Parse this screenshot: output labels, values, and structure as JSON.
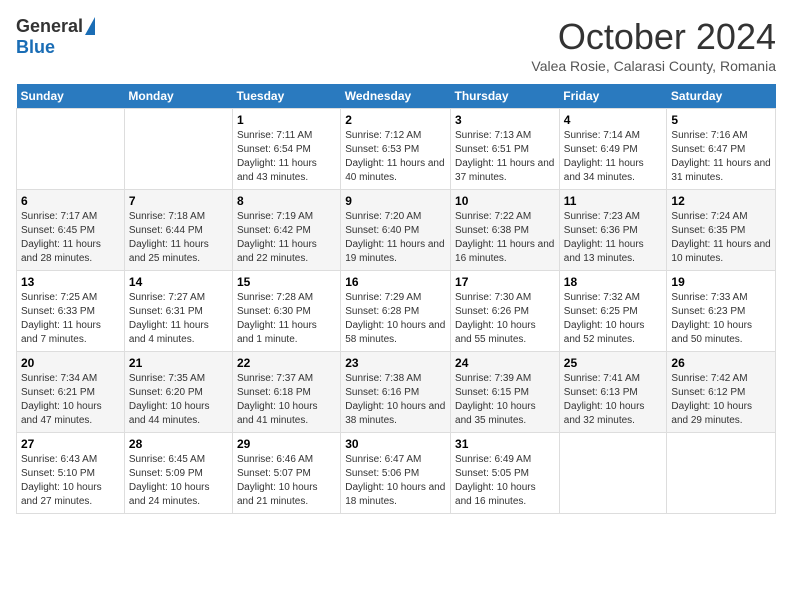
{
  "header": {
    "logo_general": "General",
    "logo_blue": "Blue",
    "month_title": "October 2024",
    "location": "Valea Rosie, Calarasi County, Romania"
  },
  "days_of_week": [
    "Sunday",
    "Monday",
    "Tuesday",
    "Wednesday",
    "Thursday",
    "Friday",
    "Saturday"
  ],
  "weeks": [
    [
      {
        "day": "",
        "sunrise": "",
        "sunset": "",
        "daylight": ""
      },
      {
        "day": "",
        "sunrise": "",
        "sunset": "",
        "daylight": ""
      },
      {
        "day": "1",
        "sunrise": "Sunrise: 7:11 AM",
        "sunset": "Sunset: 6:54 PM",
        "daylight": "Daylight: 11 hours and 43 minutes."
      },
      {
        "day": "2",
        "sunrise": "Sunrise: 7:12 AM",
        "sunset": "Sunset: 6:53 PM",
        "daylight": "Daylight: 11 hours and 40 minutes."
      },
      {
        "day": "3",
        "sunrise": "Sunrise: 7:13 AM",
        "sunset": "Sunset: 6:51 PM",
        "daylight": "Daylight: 11 hours and 37 minutes."
      },
      {
        "day": "4",
        "sunrise": "Sunrise: 7:14 AM",
        "sunset": "Sunset: 6:49 PM",
        "daylight": "Daylight: 11 hours and 34 minutes."
      },
      {
        "day": "5",
        "sunrise": "Sunrise: 7:16 AM",
        "sunset": "Sunset: 6:47 PM",
        "daylight": "Daylight: 11 hours and 31 minutes."
      }
    ],
    [
      {
        "day": "6",
        "sunrise": "Sunrise: 7:17 AM",
        "sunset": "Sunset: 6:45 PM",
        "daylight": "Daylight: 11 hours and 28 minutes."
      },
      {
        "day": "7",
        "sunrise": "Sunrise: 7:18 AM",
        "sunset": "Sunset: 6:44 PM",
        "daylight": "Daylight: 11 hours and 25 minutes."
      },
      {
        "day": "8",
        "sunrise": "Sunrise: 7:19 AM",
        "sunset": "Sunset: 6:42 PM",
        "daylight": "Daylight: 11 hours and 22 minutes."
      },
      {
        "day": "9",
        "sunrise": "Sunrise: 7:20 AM",
        "sunset": "Sunset: 6:40 PM",
        "daylight": "Daylight: 11 hours and 19 minutes."
      },
      {
        "day": "10",
        "sunrise": "Sunrise: 7:22 AM",
        "sunset": "Sunset: 6:38 PM",
        "daylight": "Daylight: 11 hours and 16 minutes."
      },
      {
        "day": "11",
        "sunrise": "Sunrise: 7:23 AM",
        "sunset": "Sunset: 6:36 PM",
        "daylight": "Daylight: 11 hours and 13 minutes."
      },
      {
        "day": "12",
        "sunrise": "Sunrise: 7:24 AM",
        "sunset": "Sunset: 6:35 PM",
        "daylight": "Daylight: 11 hours and 10 minutes."
      }
    ],
    [
      {
        "day": "13",
        "sunrise": "Sunrise: 7:25 AM",
        "sunset": "Sunset: 6:33 PM",
        "daylight": "Daylight: 11 hours and 7 minutes."
      },
      {
        "day": "14",
        "sunrise": "Sunrise: 7:27 AM",
        "sunset": "Sunset: 6:31 PM",
        "daylight": "Daylight: 11 hours and 4 minutes."
      },
      {
        "day": "15",
        "sunrise": "Sunrise: 7:28 AM",
        "sunset": "Sunset: 6:30 PM",
        "daylight": "Daylight: 11 hours and 1 minute."
      },
      {
        "day": "16",
        "sunrise": "Sunrise: 7:29 AM",
        "sunset": "Sunset: 6:28 PM",
        "daylight": "Daylight: 10 hours and 58 minutes."
      },
      {
        "day": "17",
        "sunrise": "Sunrise: 7:30 AM",
        "sunset": "Sunset: 6:26 PM",
        "daylight": "Daylight: 10 hours and 55 minutes."
      },
      {
        "day": "18",
        "sunrise": "Sunrise: 7:32 AM",
        "sunset": "Sunset: 6:25 PM",
        "daylight": "Daylight: 10 hours and 52 minutes."
      },
      {
        "day": "19",
        "sunrise": "Sunrise: 7:33 AM",
        "sunset": "Sunset: 6:23 PM",
        "daylight": "Daylight: 10 hours and 50 minutes."
      }
    ],
    [
      {
        "day": "20",
        "sunrise": "Sunrise: 7:34 AM",
        "sunset": "Sunset: 6:21 PM",
        "daylight": "Daylight: 10 hours and 47 minutes."
      },
      {
        "day": "21",
        "sunrise": "Sunrise: 7:35 AM",
        "sunset": "Sunset: 6:20 PM",
        "daylight": "Daylight: 10 hours and 44 minutes."
      },
      {
        "day": "22",
        "sunrise": "Sunrise: 7:37 AM",
        "sunset": "Sunset: 6:18 PM",
        "daylight": "Daylight: 10 hours and 41 minutes."
      },
      {
        "day": "23",
        "sunrise": "Sunrise: 7:38 AM",
        "sunset": "Sunset: 6:16 PM",
        "daylight": "Daylight: 10 hours and 38 minutes."
      },
      {
        "day": "24",
        "sunrise": "Sunrise: 7:39 AM",
        "sunset": "Sunset: 6:15 PM",
        "daylight": "Daylight: 10 hours and 35 minutes."
      },
      {
        "day": "25",
        "sunrise": "Sunrise: 7:41 AM",
        "sunset": "Sunset: 6:13 PM",
        "daylight": "Daylight: 10 hours and 32 minutes."
      },
      {
        "day": "26",
        "sunrise": "Sunrise: 7:42 AM",
        "sunset": "Sunset: 6:12 PM",
        "daylight": "Daylight: 10 hours and 29 minutes."
      }
    ],
    [
      {
        "day": "27",
        "sunrise": "Sunrise: 6:43 AM",
        "sunset": "Sunset: 5:10 PM",
        "daylight": "Daylight: 10 hours and 27 minutes."
      },
      {
        "day": "28",
        "sunrise": "Sunrise: 6:45 AM",
        "sunset": "Sunset: 5:09 PM",
        "daylight": "Daylight: 10 hours and 24 minutes."
      },
      {
        "day": "29",
        "sunrise": "Sunrise: 6:46 AM",
        "sunset": "Sunset: 5:07 PM",
        "daylight": "Daylight: 10 hours and 21 minutes."
      },
      {
        "day": "30",
        "sunrise": "Sunrise: 6:47 AM",
        "sunset": "Sunset: 5:06 PM",
        "daylight": "Daylight: 10 hours and 18 minutes."
      },
      {
        "day": "31",
        "sunrise": "Sunrise: 6:49 AM",
        "sunset": "Sunset: 5:05 PM",
        "daylight": "Daylight: 10 hours and 16 minutes."
      },
      {
        "day": "",
        "sunrise": "",
        "sunset": "",
        "daylight": ""
      },
      {
        "day": "",
        "sunrise": "",
        "sunset": "",
        "daylight": ""
      }
    ]
  ]
}
